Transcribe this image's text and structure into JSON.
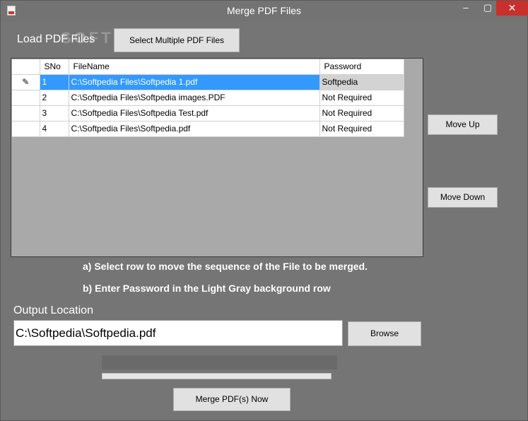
{
  "window": {
    "title": "Merge PDF Files",
    "minimize_glyph": "‒",
    "maximize_glyph": "▢",
    "close_glyph": "✕",
    "icon": "pdf-app-icon"
  },
  "load": {
    "label": "Load PDF Files",
    "watermark": "SOFTPEDIA",
    "select_button": "Select Multiple PDF Files"
  },
  "grid": {
    "columns": [
      "SNo",
      "FileName",
      "Password"
    ],
    "edit_glyph": "✎",
    "rows": [
      {
        "sno": "1",
        "file": "C:\\Softpedia Files\\Softpedia 1.pdf",
        "password": "Softpedia",
        "selected": true
      },
      {
        "sno": "2",
        "file": "C:\\Softpedia Files\\Softpedia images.PDF",
        "password": "Not Required",
        "selected": false
      },
      {
        "sno": "3",
        "file": "C:\\Softpedia Files\\Softpedia Test.pdf",
        "password": "Not Required",
        "selected": false
      },
      {
        "sno": "4",
        "file": "C:\\Softpedia Files\\Softpedia.pdf",
        "password": "Not Required",
        "selected": false
      }
    ]
  },
  "buttons": {
    "move_up": "Move Up",
    "move_down": "Move Down",
    "browse": "Browse",
    "merge": "Merge  PDF(s) Now"
  },
  "instructions": {
    "a": "a) Select row to move the sequence of the File to be merged.",
    "b": "b) Enter Password in the Light Gray background row"
  },
  "output": {
    "label": "Output Location",
    "value": "C:\\Softpedia\\Softpedia.pdf"
  },
  "progress": {
    "value": 0
  },
  "colors": {
    "background": "#757575",
    "selection": "#3399ff",
    "password_row": "#d3d3d3",
    "close_button": "#c9302c"
  }
}
